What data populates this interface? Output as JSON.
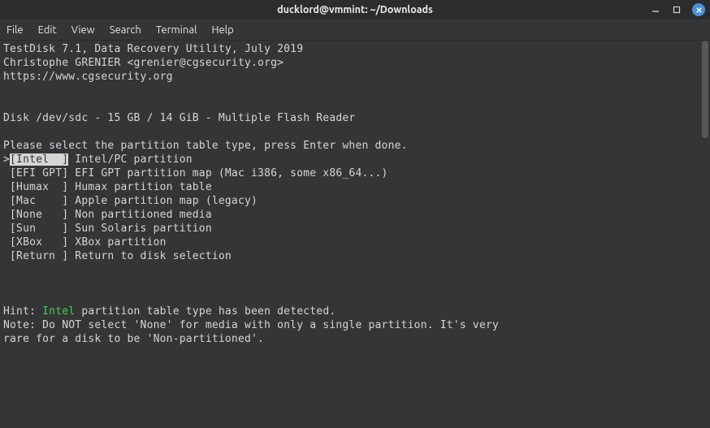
{
  "titlebar": {
    "title": "ducklord@vmmint: ~/Downloads"
  },
  "menubar": {
    "file": "File",
    "edit": "Edit",
    "view": "View",
    "search": "Search",
    "terminal": "Terminal",
    "help": "Help"
  },
  "term": {
    "l1": "TestDisk 7.1, Data Recovery Utility, July 2019",
    "l2": "Christophe GRENIER <grenier@cgsecurity.org>",
    "l3": "https://www.cgsecurity.org",
    "blank": "",
    "disk": "Disk /dev/sdc - 15 GB / 14 GiB - Multiple Flash Reader",
    "prompt": "Please select the partition table type, press Enter when done.",
    "opt_sel_prefix": ">",
    "opt_intel_label": "[Intel  ]",
    "opt_intel_desc": " Intel/PC partition",
    "opt_efi": " [EFI GPT] EFI GPT partition map (Mac i386, some x86_64...)",
    "opt_humax": " [Humax  ] Humax partition table",
    "opt_mac": " [Mac    ] Apple partition map (legacy)",
    "opt_none": " [None   ] Non partitioned media",
    "opt_sun": " [Sun    ] Sun Solaris partition",
    "opt_xbox": " [XBox   ] XBox partition",
    "opt_return": " [Return ] Return to disk selection",
    "hint_prefix": "Hint: ",
    "hint_word": "Intel",
    "hint_suffix": " partition table type has been detected.",
    "note1": "Note: Do NOT select 'None' for media with only a single partition. It's very",
    "note2": "rare for a disk to be 'Non-partitioned'."
  }
}
